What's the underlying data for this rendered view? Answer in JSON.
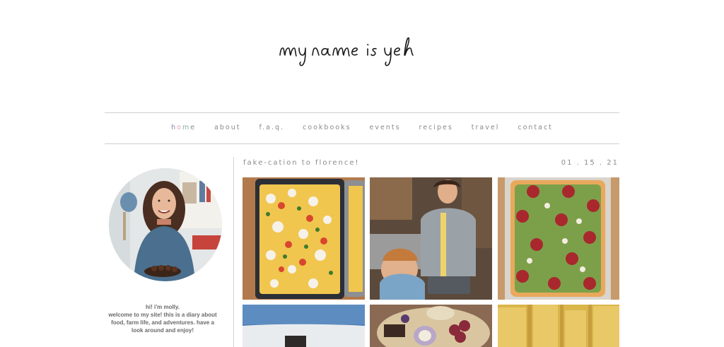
{
  "site": {
    "logo_text": "my name is yeh"
  },
  "nav": {
    "items": [
      {
        "label": "home",
        "name": "nav-home"
      },
      {
        "label": "about",
        "name": "nav-about"
      },
      {
        "label": "f.a.q.",
        "name": "nav-faq"
      },
      {
        "label": "cookbooks",
        "name": "nav-cookbooks"
      },
      {
        "label": "events",
        "name": "nav-events"
      },
      {
        "label": "recipes",
        "name": "nav-recipes"
      },
      {
        "label": "travel",
        "name": "nav-travel"
      },
      {
        "label": "contact",
        "name": "nav-contact"
      }
    ]
  },
  "sidebar": {
    "bio_lines": [
      "hi! i'm molly.",
      "welcome to my site! this is a diary about",
      "food, farm life, and adventures. have a",
      "look around and enjoy!"
    ]
  },
  "post": {
    "title": "fake-cation to florence!",
    "date": "01 . 15 . 21"
  },
  "colors": {
    "nav_text": "#8a8a8a",
    "rule": "#cfcfcf",
    "accent_home": [
      "#7f8aa8",
      "#e6a0a6",
      "#7fb0a8"
    ]
  }
}
